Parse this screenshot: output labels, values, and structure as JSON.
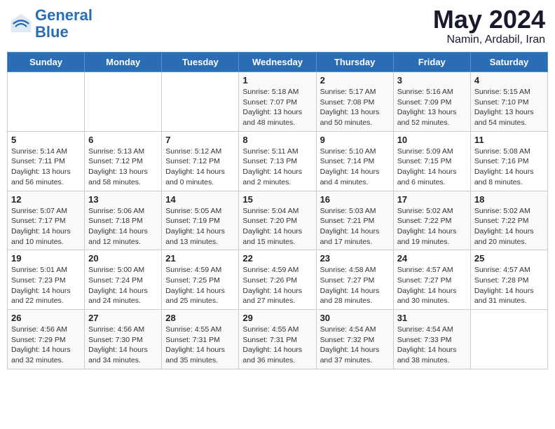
{
  "header": {
    "logo_line1": "General",
    "logo_line2": "Blue",
    "month": "May 2024",
    "location": "Namin, Ardabil, Iran"
  },
  "days_of_week": [
    "Sunday",
    "Monday",
    "Tuesday",
    "Wednesday",
    "Thursday",
    "Friday",
    "Saturday"
  ],
  "weeks": [
    [
      null,
      null,
      null,
      {
        "day": 1,
        "sunrise": "5:18 AM",
        "sunset": "7:07 PM",
        "daylight": "13 hours and 48 minutes."
      },
      {
        "day": 2,
        "sunrise": "5:17 AM",
        "sunset": "7:08 PM",
        "daylight": "13 hours and 50 minutes."
      },
      {
        "day": 3,
        "sunrise": "5:16 AM",
        "sunset": "7:09 PM",
        "daylight": "13 hours and 52 minutes."
      },
      {
        "day": 4,
        "sunrise": "5:15 AM",
        "sunset": "7:10 PM",
        "daylight": "13 hours and 54 minutes."
      }
    ],
    [
      {
        "day": 5,
        "sunrise": "5:14 AM",
        "sunset": "7:11 PM",
        "daylight": "13 hours and 56 minutes."
      },
      {
        "day": 6,
        "sunrise": "5:13 AM",
        "sunset": "7:12 PM",
        "daylight": "13 hours and 58 minutes."
      },
      {
        "day": 7,
        "sunrise": "5:12 AM",
        "sunset": "7:12 PM",
        "daylight": "14 hours and 0 minutes."
      },
      {
        "day": 8,
        "sunrise": "5:11 AM",
        "sunset": "7:13 PM",
        "daylight": "14 hours and 2 minutes."
      },
      {
        "day": 9,
        "sunrise": "5:10 AM",
        "sunset": "7:14 PM",
        "daylight": "14 hours and 4 minutes."
      },
      {
        "day": 10,
        "sunrise": "5:09 AM",
        "sunset": "7:15 PM",
        "daylight": "14 hours and 6 minutes."
      },
      {
        "day": 11,
        "sunrise": "5:08 AM",
        "sunset": "7:16 PM",
        "daylight": "14 hours and 8 minutes."
      }
    ],
    [
      {
        "day": 12,
        "sunrise": "5:07 AM",
        "sunset": "7:17 PM",
        "daylight": "14 hours and 10 minutes."
      },
      {
        "day": 13,
        "sunrise": "5:06 AM",
        "sunset": "7:18 PM",
        "daylight": "14 hours and 12 minutes."
      },
      {
        "day": 14,
        "sunrise": "5:05 AM",
        "sunset": "7:19 PM",
        "daylight": "14 hours and 13 minutes."
      },
      {
        "day": 15,
        "sunrise": "5:04 AM",
        "sunset": "7:20 PM",
        "daylight": "14 hours and 15 minutes."
      },
      {
        "day": 16,
        "sunrise": "5:03 AM",
        "sunset": "7:21 PM",
        "daylight": "14 hours and 17 minutes."
      },
      {
        "day": 17,
        "sunrise": "5:02 AM",
        "sunset": "7:22 PM",
        "daylight": "14 hours and 19 minutes."
      },
      {
        "day": 18,
        "sunrise": "5:02 AM",
        "sunset": "7:22 PM",
        "daylight": "14 hours and 20 minutes."
      }
    ],
    [
      {
        "day": 19,
        "sunrise": "5:01 AM",
        "sunset": "7:23 PM",
        "daylight": "14 hours and 22 minutes."
      },
      {
        "day": 20,
        "sunrise": "5:00 AM",
        "sunset": "7:24 PM",
        "daylight": "14 hours and 24 minutes."
      },
      {
        "day": 21,
        "sunrise": "4:59 AM",
        "sunset": "7:25 PM",
        "daylight": "14 hours and 25 minutes."
      },
      {
        "day": 22,
        "sunrise": "4:59 AM",
        "sunset": "7:26 PM",
        "daylight": "14 hours and 27 minutes."
      },
      {
        "day": 23,
        "sunrise": "4:58 AM",
        "sunset": "7:27 PM",
        "daylight": "14 hours and 28 minutes."
      },
      {
        "day": 24,
        "sunrise": "4:57 AM",
        "sunset": "7:27 PM",
        "daylight": "14 hours and 30 minutes."
      },
      {
        "day": 25,
        "sunrise": "4:57 AM",
        "sunset": "7:28 PM",
        "daylight": "14 hours and 31 minutes."
      }
    ],
    [
      {
        "day": 26,
        "sunrise": "4:56 AM",
        "sunset": "7:29 PM",
        "daylight": "14 hours and 32 minutes."
      },
      {
        "day": 27,
        "sunrise": "4:56 AM",
        "sunset": "7:30 PM",
        "daylight": "14 hours and 34 minutes."
      },
      {
        "day": 28,
        "sunrise": "4:55 AM",
        "sunset": "7:31 PM",
        "daylight": "14 hours and 35 minutes."
      },
      {
        "day": 29,
        "sunrise": "4:55 AM",
        "sunset": "7:31 PM",
        "daylight": "14 hours and 36 minutes."
      },
      {
        "day": 30,
        "sunrise": "4:54 AM",
        "sunset": "7:32 PM",
        "daylight": "14 hours and 37 minutes."
      },
      {
        "day": 31,
        "sunrise": "4:54 AM",
        "sunset": "7:33 PM",
        "daylight": "14 hours and 38 minutes."
      },
      null
    ]
  ],
  "labels": {
    "sunrise_label": "Sunrise:",
    "sunset_label": "Sunset:",
    "daylight_label": "Daylight:"
  }
}
